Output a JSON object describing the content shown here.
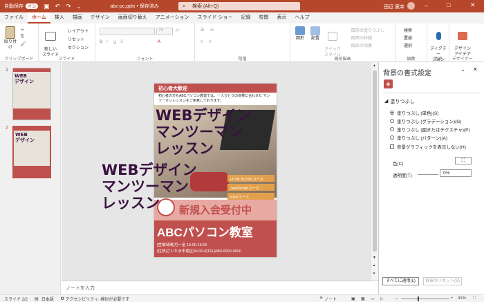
{
  "titlebar": {
    "autosave": "自動保存",
    "autosave_state": "オン",
    "filename": "abc-pc.pptx • 保存済み",
    "search": "検索 (Alt+Q)",
    "user": "田辺 寛幸"
  },
  "tabs": [
    "ファイル",
    "ホーム",
    "挿入",
    "描画",
    "デザイン",
    "画面切り替え",
    "アニメーション",
    "スライド ショー",
    "記録",
    "校閲",
    "表示",
    "ヘルプ"
  ],
  "ribbon": {
    "paste": "貼り付け",
    "clipboard": "クリップボード",
    "new_slide": "新しい\nスライド",
    "layout": "レイアウト",
    "reset": "リセット",
    "section": "セクション",
    "slides_group": "スライド",
    "font_group": "フォント",
    "font_size": "75",
    "paragraph": "段落",
    "shapes": "図形",
    "arrange": "配置",
    "quick_styles": "クイック\nスタイル",
    "fill": "図形の塗りつぶし",
    "outline": "図形の枠線",
    "effect": "図形の効果",
    "drawing": "図形描画",
    "find": "検索",
    "replace": "置換",
    "select": "選択",
    "editing": "編集",
    "dictate": "ディクテー\nション",
    "voice": "音声",
    "designer": "デザイン\nアイデア",
    "designer_group": "デザイナー",
    "record": "記録",
    "share_icon": "共有"
  },
  "slides": [
    {
      "num": "1"
    },
    {
      "num": "2"
    }
  ],
  "slide": {
    "header": "初心者大歓迎",
    "intro": "初心者の方もABCパソコン教室では、一人ひとりの目標に合わせた マンツーマンレッスンをご用意しております。",
    "big_title_lines": [
      "WEBデザイン",
      "マンツーマン",
      "レッスン"
    ],
    "courses": [
      "HTML＆CSSコース",
      "JavaScriptコース",
      "PHPコース"
    ],
    "recruit": "新規入会受付中",
    "school": "ABCパソコン教室",
    "hours": "[営業時間]月～金  10:00-16:00",
    "address": "[住所]さいたま市南区00-00-0[TEL]080-0000-0000"
  },
  "notes_placeholder": "ノートを入力",
  "pane": {
    "title": "背景の書式設定",
    "section": "塗りつぶし",
    "options": [
      "塗りつぶし (単色)(S)",
      "塗りつぶし (グラデーション)(G)",
      "塗りつぶし (図またはテクスチャ)(P)",
      "塗りつぶし (パターン)(A)"
    ],
    "hide_bg": "背景グラフィックを表示しない(H)",
    "color_label": "色(C)",
    "transparency_label": "透明度(T)",
    "transparency_value": "0%",
    "apply_all": "すべてに適用(L)",
    "reset_bg": "背景のリセット(B)"
  },
  "status": {
    "slide": "スライド 2/2",
    "lang": "日本語",
    "access": "アクセシビリティ: 検討が必要です",
    "notes": "ノート",
    "zoom": "41%"
  },
  "colors": {
    "accent": "#b7472a",
    "slide_red": "#c0504d",
    "course_orange": "#e3a04c",
    "title_purple": "#3a1340"
  }
}
